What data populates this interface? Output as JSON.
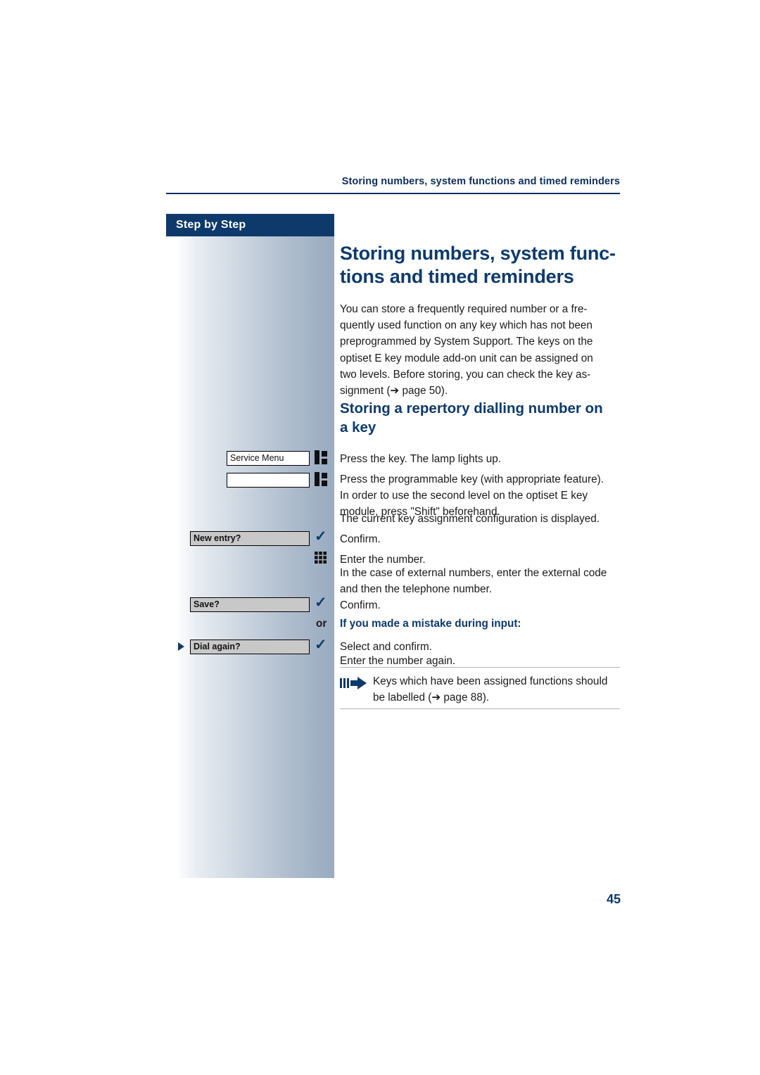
{
  "header": {
    "running_head": "Storing numbers, system functions and timed reminders",
    "step_by_step": "Step by Step"
  },
  "titles": {
    "h1": "Storing numbers, system func- tions and timed reminders",
    "h2": "Storing a repertory dialling number on a key"
  },
  "content": {
    "intro": "You can store a frequently required number or a fre-quently used function on any key which has not been preprogrammed by System Support. The keys on the optiset E key module add-on unit can be assigned on two levels. Before storing, you can check the key as-signment (→ page 50).",
    "press_key": "Press the key. The lamp lights up.",
    "press_programmable": "Press the programmable key (with appropriate feature). In order to use the second level on the optiset E key module, press \"Shift\" beforehand.",
    "current_key": "The current key assignment configuration is displayed.",
    "confirm_1": "Confirm.",
    "enter_number": "Enter the number.",
    "external_numbers": "In the case of external numbers, enter the external code and then the telephone number.",
    "confirm_2": "Confirm.",
    "or": "or",
    "mistake_heading": "If you made a mistake during input:",
    "select_and_confirm": "Select and confirm.",
    "enter_number_again": "Enter the number again.",
    "note": "Keys which have been assigned functions should be labelled (→ page 88)."
  },
  "display_keys": {
    "service_menu": "Service Menu",
    "blank": "",
    "new_entry": "New entry?",
    "save": "Save?",
    "dial_again": "Dial again?"
  },
  "page_number": "45",
  "colors": {
    "brand_blue": "#0d3a6b",
    "head_blue": "#0d2f5c",
    "display_grey": "#c8c8c8"
  }
}
